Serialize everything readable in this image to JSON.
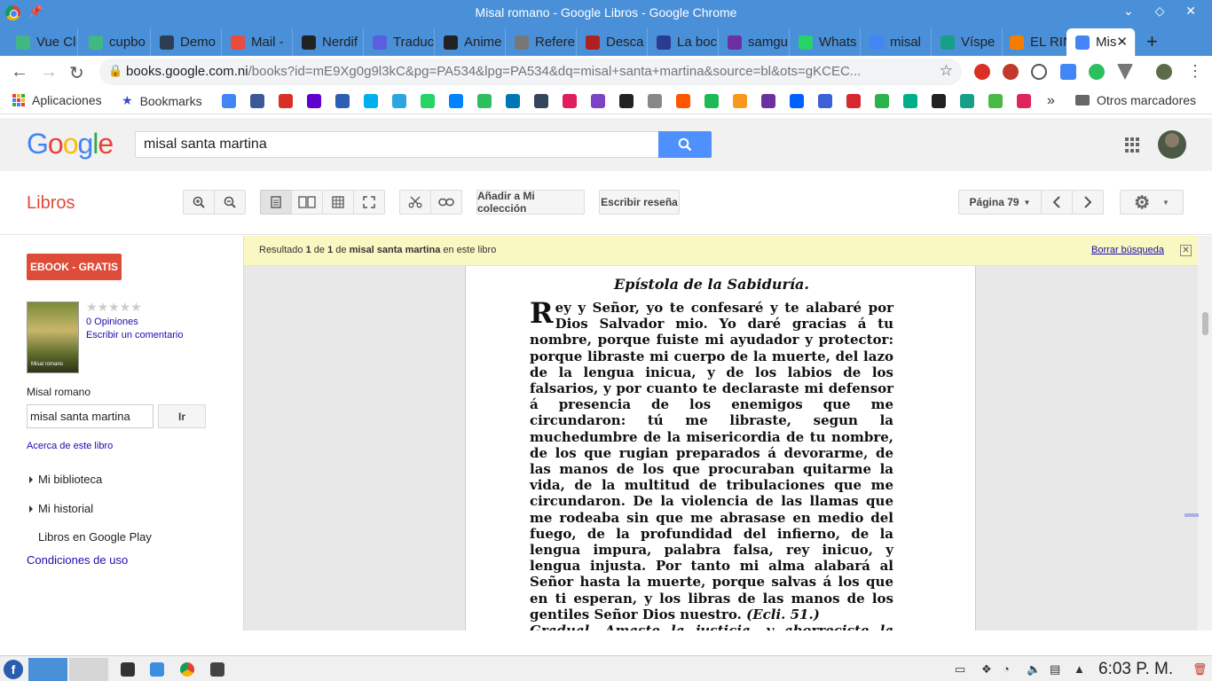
{
  "window": {
    "title": "Misal romano - Google Libros - Google Chrome"
  },
  "tabs": [
    {
      "label": "Vue Cl",
      "color": "#41b883"
    },
    {
      "label": "cupbo",
      "color": "#41b883"
    },
    {
      "label": "Demo",
      "color": "#2c3e50"
    },
    {
      "label": "Mail -",
      "color": "#e74c3c"
    },
    {
      "label": "Nerdif",
      "color": "#222222"
    },
    {
      "label": "Traduc",
      "color": "#5a5ee0"
    },
    {
      "label": "Anime",
      "color": "#222222"
    },
    {
      "label": "Refere",
      "color": "#777777"
    },
    {
      "label": "Desca",
      "color": "#b02020"
    },
    {
      "label": "La boc",
      "color": "#2b3b8f"
    },
    {
      "label": "samgu",
      "color": "#6b2fa0"
    },
    {
      "label": "Whats",
      "color": "#25d366"
    },
    {
      "label": "misal",
      "color": "#4285f4"
    },
    {
      "label": "Víspe",
      "color": "#17a085"
    },
    {
      "label": "EL RIN",
      "color": "#f57d00"
    },
    {
      "label": "Mis",
      "color": "#4285f4",
      "active": true
    }
  ],
  "omnibox": {
    "url_host": "books.google.com.ni",
    "url_path": "/books?id=mE9Xg0g9l3kC&pg=PA534&lpg=PA534&dq=misal+santa+martina&source=bl&ots=gKCEC..."
  },
  "bookmarks": {
    "apps_label": "Aplicaciones",
    "bookmarks_label": "Bookmarks",
    "more": "»",
    "other_label": "Otros marcadores"
  },
  "google": {
    "logo": [
      "G",
      "o",
      "o",
      "g",
      "l",
      "e"
    ],
    "logo_colors": [
      "#4285f4",
      "#ea4335",
      "#fbbc05",
      "#4285f4",
      "#34a853",
      "#ea4335"
    ],
    "query": "misal santa martina"
  },
  "books_toolbar": {
    "section": "Libros",
    "add_collection": "Añadir a Mi colección",
    "write_review": "Escribir reseña",
    "page_select": "Página 79"
  },
  "sidebar": {
    "ebook_button": "EBOOK - GRATIS",
    "cover_caption": "Misal romano",
    "stars": "★★★★★",
    "opinions": "0 Opiniones",
    "write_comment": "Escribir un comentario",
    "book_title": "Misal romano",
    "search_value": "misal santa martina",
    "go_button": "Ir",
    "about": "Acerca de este libro",
    "my_library": "Mi biblioteca",
    "my_history": "Mi historial",
    "play_books": "Libros en Google Play",
    "terms": "Condiciones de uso"
  },
  "result_bar": {
    "prefix": "Resultado",
    "current": "1",
    "of": "de",
    "total": "1",
    "de2": "de",
    "query": "misal santa martina",
    "suffix": "en este libro",
    "clear": "Borrar búsqueda"
  },
  "page_scan": {
    "heading": "Epístola de la Sabiduría.",
    "drop_cap": "R",
    "body": "ey y Señor, yo te confesaré y te alabaré por Dios Salvador mio. Yo daré gracias á tu nombre, porque fuiste mi ayudador y protector: porque libraste mi cuerpo de la muerte, del lazo de la lengua inicua, y de los labios de los falsarios, y por cuanto te declaraste mi defensor á presencia de los enemigos que me circundaron: tú me libraste, segun la muchedumbre de la misericordia de tu nombre, de los que rugian preparados á devorarme, de las manos de los que procuraban quitarme la vida, de la multitud de tribulaciones que me circundaron. De la violencia de las llamas que me rodeaba sin que me abrasase en medio del fuego, de la profundidad del infierno, de la lengua impura, palabra falsa, rey inicuo, y lengua injusta. Por tanto mi alma alabará al Señor hasta la muerte, porque salvas á los que en ti esperan, y los libras de las manos de los gentiles Señor Dios nuestro.",
    "citation": "(Ecli. 51.)",
    "gradual": "Gradual. Amaste la justicia, y aborreciste la maldad. ℣. Por lo mismo te ungió Dios, Dios tuyo, con"
  },
  "taskbar": {
    "clock": "6:03 P. M."
  }
}
